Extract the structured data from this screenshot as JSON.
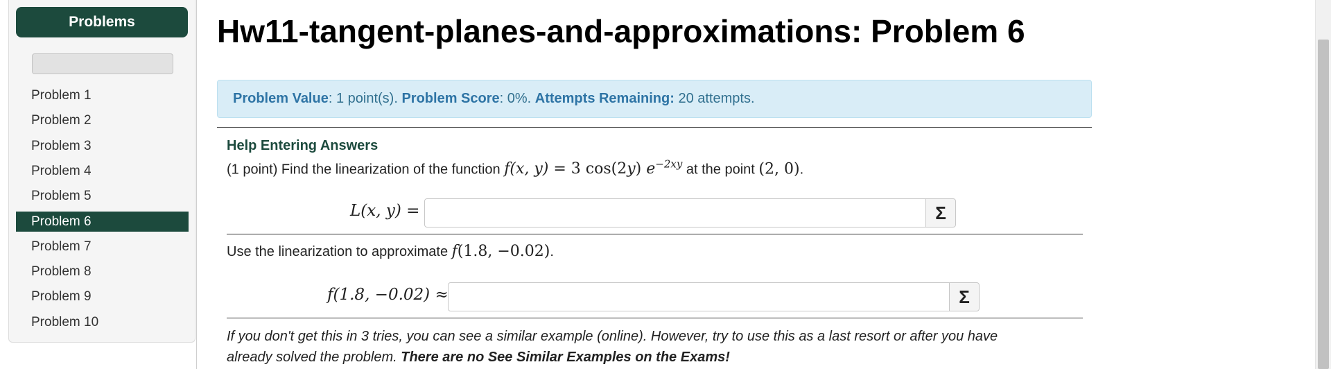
{
  "sidebar": {
    "header": "Problems",
    "items": [
      {
        "label": "Problem 1"
      },
      {
        "label": "Problem 2"
      },
      {
        "label": "Problem 3"
      },
      {
        "label": "Problem 4"
      },
      {
        "label": "Problem 5"
      },
      {
        "label": "Problem 6"
      },
      {
        "label": "Problem 7"
      },
      {
        "label": "Problem 8"
      },
      {
        "label": "Problem 9"
      },
      {
        "label": "Problem 10"
      }
    ],
    "active_index": 5
  },
  "page": {
    "title": "Hw11-tangent-planes-and-approximations: Problem 6"
  },
  "info": {
    "value_label": "Problem Value",
    "value_text": ": 1 point(s). ",
    "score_label": "Problem Score",
    "score_text": ": 0%. ",
    "attempts_label": "Attempts Remaining:",
    "attempts_text": " 20 attempts."
  },
  "problem": {
    "help_link": "Help Entering Answers",
    "intro": "(1 point) Find the linearization of the function ",
    "at_point_text": " at the point ",
    "period": ".",
    "answer1_label": "L(x, y) =",
    "answer1_value": "",
    "approx_text": "Use the linearization to approximate ",
    "answer2_label": "f(1.8, −0.02) ≈",
    "answer2_value": "",
    "sigma": "Σ"
  },
  "footnote": {
    "line1": "If you don't get this in 3 tries, you can see a similar example (online). However, try to use this as a last resort or after you have",
    "line2_plain": "already solved the problem. ",
    "line2_bold": "There are no See Similar Examples on the Exams!"
  },
  "colors": {
    "brand_green": "#1c4a3d",
    "info_bg": "#d9edf7",
    "info_text": "#31708f"
  }
}
